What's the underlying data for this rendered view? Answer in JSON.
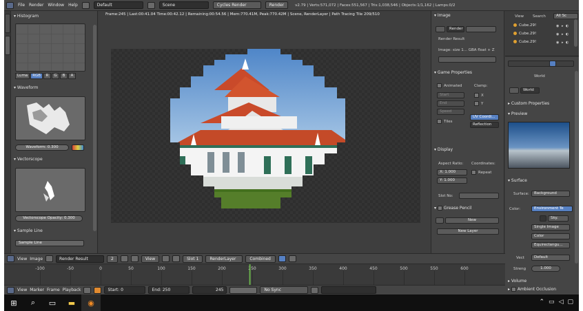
{
  "topbar": {
    "menus": [
      "File",
      "Render",
      "Window",
      "Help"
    ],
    "layout": "Default",
    "scene": "Scene",
    "engine": "Cycles Render",
    "render_button": "Render",
    "stats": "v2.79 | Verts:571,072 | Faces:551,567 | Tris:1,038,546 | Objects:1/1,162 | Lamps:0/2"
  },
  "render_info": "Frame:245 | Last:00:41.04 Time:00:42.12 | Remaining:00:54.56 | Mem:770.41M, Peak:770.42M | Scene, RenderLayer | Path Tracing Tile 209/510",
  "scopes": {
    "histogram_label": "Histogram",
    "channels": [
      "Luma",
      "RGB",
      "R",
      "G",
      "B",
      "A"
    ],
    "waveform_label": "Waveform",
    "waveform_opacity": "Waveform: 0.300",
    "vectorscope_label": "Vectorscope",
    "vectorscope_opacity": "Vectorscope Opacity: 0.300",
    "sample_line_label": "Sample Line",
    "sample_line_button": "Sample Line"
  },
  "image_panel": {
    "title": "Image",
    "render_label": "Render",
    "render_result": "Render Result",
    "image_info": "Image: size 1... GBA float + Z",
    "game_props": "Game Properties",
    "animated": "Animated",
    "clamp": "Clamp:",
    "start": "Start",
    "end": "End",
    "speed": "Speed",
    "x": "X",
    "y": "Y",
    "tiles": "Tiles",
    "uv_coord": "UV Coordi...",
    "reflection": "Reflection",
    "display": "Display",
    "aspect_ratio": "Aspect Ratio:",
    "coordinates": "Coordinates:",
    "aspect_x": "X: 1.000",
    "aspect_y": "Y: 1.000",
    "repeat": "Repeat",
    "slot_no": "Slot No:",
    "grease_pencil": "Grease Pencil",
    "new": "New",
    "new_layer": "New Layer"
  },
  "outliner": {
    "view": "View",
    "search": "Search",
    "all_scenes": "All Sc",
    "items": [
      "Cube.29!",
      "Cube.29!",
      "Cube.29!"
    ]
  },
  "world": {
    "world_tab": "World",
    "world_name": "World",
    "custom_props": "Custom Properties",
    "preview": "Preview",
    "surface_head": "Surface",
    "surface_label": "Surface:",
    "surface_value": "Background",
    "color_label": "Color:",
    "color_value": "Environment Te",
    "sky": "Sky.",
    "single_image": "Single Image",
    "color_space": "Color",
    "projection": "Equirectangu...",
    "vector_label": "Vect",
    "vector_value": "Default",
    "strength_label": "Streng",
    "strength_value": "1.000",
    "volume": "Volume",
    "ambient_occlusion": "Ambient Occlusion"
  },
  "image_header": {
    "menus": [
      "View",
      "Image"
    ],
    "image_name": "Render Result",
    "slot_num": "2",
    "view_mode": "View",
    "slot": "Slot 1",
    "layer": "RenderLayer",
    "pass": "Combined"
  },
  "timeline": {
    "ticks": [
      "-100",
      "-50",
      "0",
      "50",
      "100",
      "150",
      "200",
      "250",
      "300",
      "350",
      "400",
      "450",
      "500",
      "550",
      "600"
    ],
    "menus": [
      "View",
      "Marker",
      "Frame",
      "Playback"
    ],
    "start": "Start:",
    "start_value": "0",
    "end": "End:",
    "end_value": "250",
    "current": "245",
    "sync": "No Sync"
  },
  "colors": {
    "accent": "#5680c2",
    "panel": "#444444",
    "playhead": "#6ab04c"
  }
}
